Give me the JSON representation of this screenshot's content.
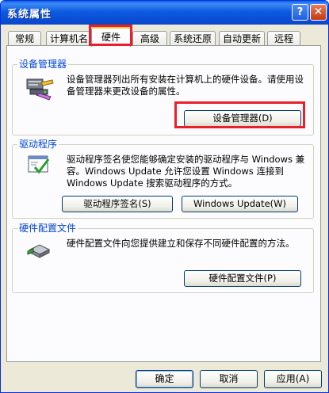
{
  "window": {
    "title": "系统属性"
  },
  "titlebar": {
    "help_glyph": "?",
    "close_glyph": "✕"
  },
  "tabs": [
    {
      "label": "常规"
    },
    {
      "label": "计算机名"
    },
    {
      "label": "硬件",
      "active": true
    },
    {
      "label": "高级"
    },
    {
      "label": "系统还原"
    },
    {
      "label": "自动更新"
    },
    {
      "label": "远程"
    }
  ],
  "device_manager": {
    "legend": "设备管理器",
    "description": "设备管理器列出所有安装在计算机上的硬件设备。请使用设备管理器来更改设备的属性。",
    "button_label": "设备管理器(D)",
    "icon": "device-manager-icon"
  },
  "drivers": {
    "legend": "驱动程序",
    "description": "驱动程序签名使您能够确定安装的驱动程序与 Windows 兼容。Windows Update 允许您设置 Windows 连接到 Windows Update 搜索驱动程序的方式。",
    "signing_button_label": "驱动程序签名(S)",
    "update_button_label": "Windows Update(W)",
    "icon": "driver-signing-icon"
  },
  "hardware_profiles": {
    "legend": "硬件配置文件",
    "description": "硬件配置文件向您提供建立和保存不同硬件配置的方法。",
    "button_label": "硬件配置文件(P)",
    "icon": "hardware-profile-icon"
  },
  "footer": {
    "ok_label": "确定",
    "cancel_label": "取消",
    "apply_label": "应用(A)"
  },
  "colors": {
    "titlebar": "#0a5fe8",
    "dialog_bg": "#ece9d8",
    "panel_bg": "#fcfcfe",
    "group_label": "#0046d5",
    "highlight_box": "#e8202a"
  }
}
